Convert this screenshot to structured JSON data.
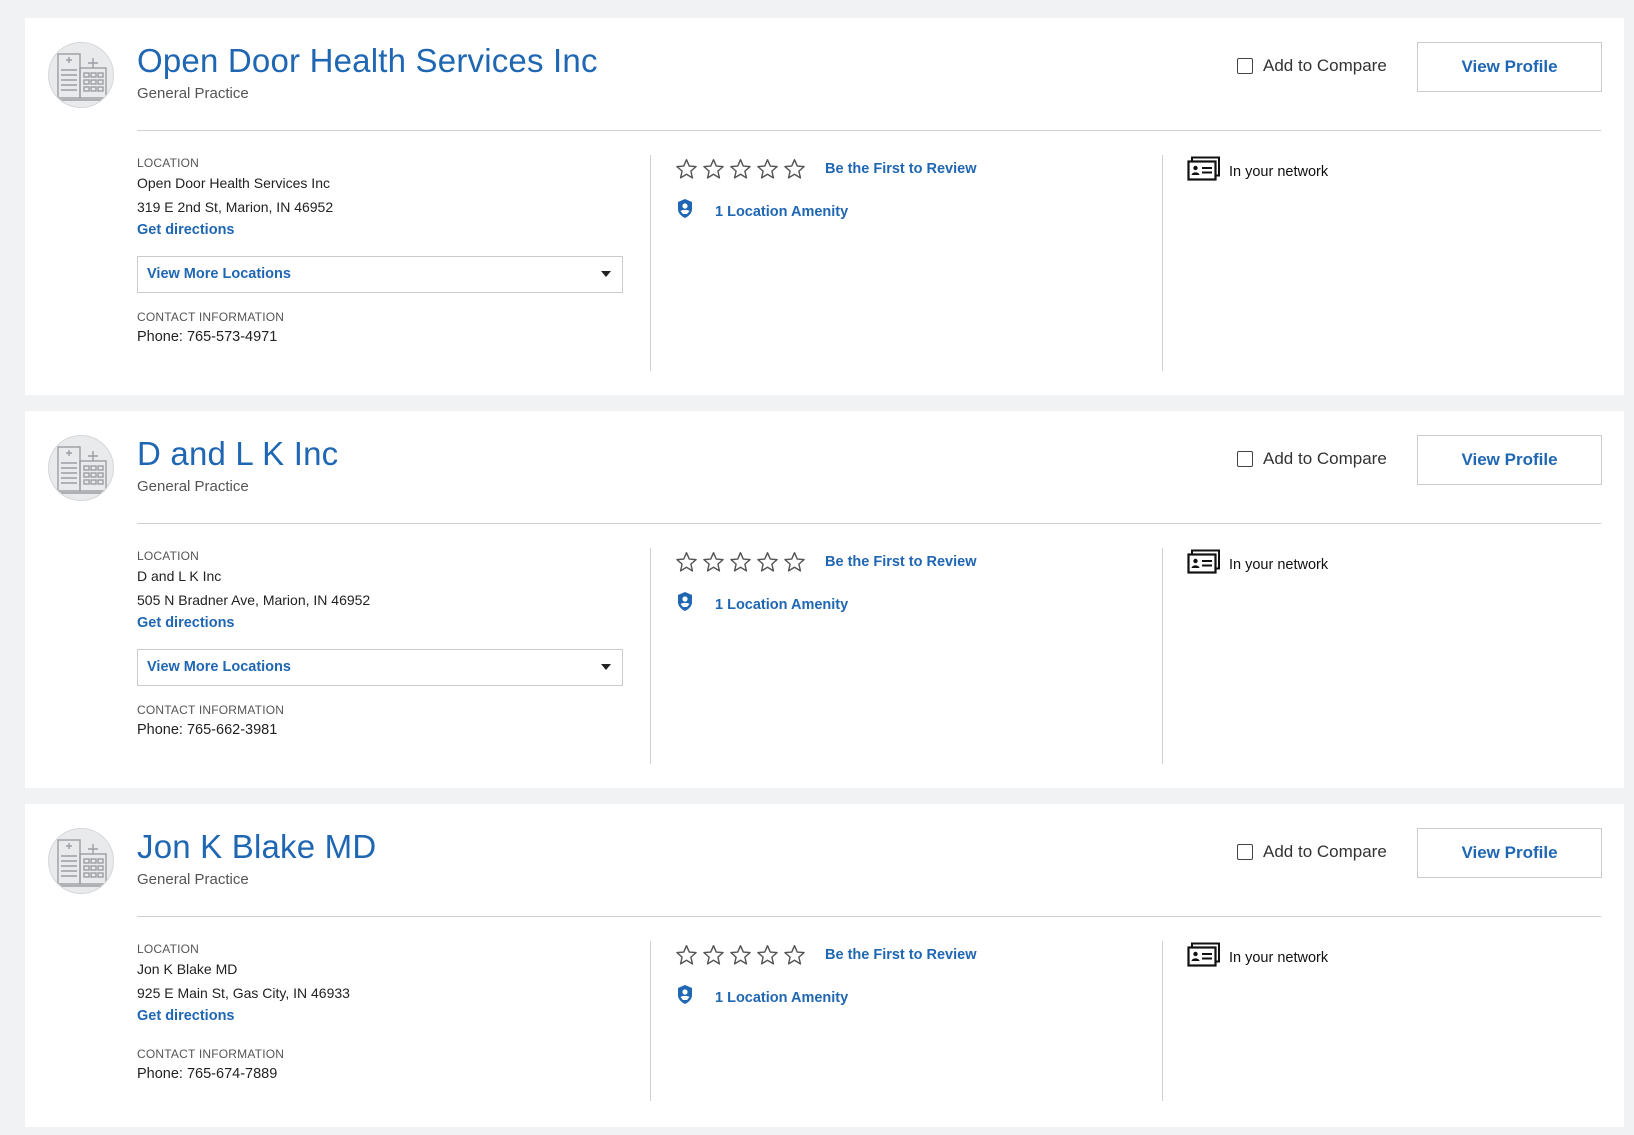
{
  "providers": [
    {
      "name": "Open Door Health Services Inc",
      "specialty": "General Practice",
      "compare_label": "Add to Compare",
      "view_profile_label": "View Profile",
      "location_label": "LOCATION",
      "location_name": "Open Door Health Services Inc",
      "address": "319 E 2nd St, Marion, IN 46952",
      "directions_label": "Get directions",
      "more_locations_label": "View More Locations",
      "contact_label": "CONTACT INFORMATION",
      "phone": "Phone: 765-573-4971",
      "rating_stars": 0,
      "review_label": "Be the First to Review",
      "amenity_label": "1 Location Amenity",
      "network_label": "In your network"
    },
    {
      "name": "D and L K Inc",
      "specialty": "General Practice",
      "compare_label": "Add to Compare",
      "view_profile_label": "View Profile",
      "location_label": "LOCATION",
      "location_name": "D and L K Inc",
      "address": "505 N Bradner Ave, Marion, IN 46952",
      "directions_label": "Get directions",
      "more_locations_label": "View More Locations",
      "contact_label": "CONTACT INFORMATION",
      "phone": "Phone: 765-662-3981",
      "rating_stars": 0,
      "review_label": "Be the First to Review",
      "amenity_label": "1 Location Amenity",
      "network_label": "In your network"
    },
    {
      "name": "Jon K Blake MD",
      "specialty": "General Practice",
      "compare_label": "Add to Compare",
      "view_profile_label": "View Profile",
      "location_label": "LOCATION",
      "location_name": "Jon K Blake MD",
      "address": "925 E Main St, Gas City, IN 46933",
      "directions_label": "Get directions",
      "contact_label": "CONTACT INFORMATION",
      "phone": "Phone: 765-674-7889",
      "rating_stars": 0,
      "review_label": "Be the First to Review",
      "amenity_label": "1 Location Amenity",
      "network_label": "In your network"
    }
  ],
  "icons": {
    "avatar": "hospital-building-icon",
    "star": "star-outline-icon",
    "amenity": "amenity-badge-icon",
    "network": "network-card-icon",
    "caret": "caret-down-icon"
  },
  "colors": {
    "link": "#1f66b3",
    "background": "#f1f2f4",
    "card": "#ffffff"
  }
}
